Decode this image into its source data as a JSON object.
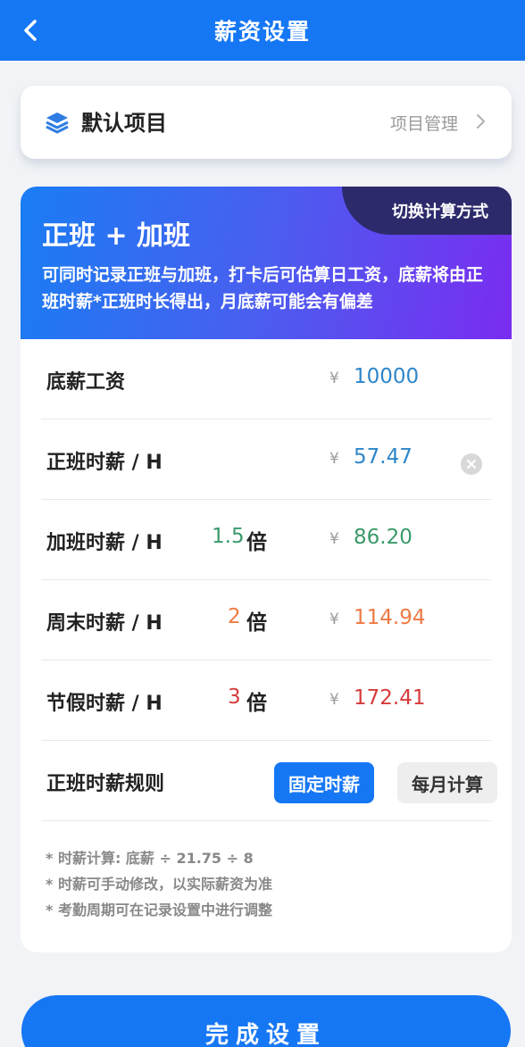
{
  "header": {
    "title": "薪资设置"
  },
  "default_project": {
    "label": "默认项目",
    "manage": "项目管理"
  },
  "mode": {
    "switch_label": "切换计算方式",
    "title": "正班 + 加班",
    "description": "可同时记录正班与加班，打卡后可估算日工资，底薪将由正班时薪*正班时长得出，月底薪可能会有偏差"
  },
  "currency_symbol": "¥",
  "rows": {
    "base": {
      "name": "底薪工资",
      "amount": "10000",
      "color": "#2e86c9"
    },
    "regular": {
      "name": "正班时薪 / H",
      "amount": "57.47",
      "color": "#2e86c9"
    },
    "overtime": {
      "name": "加班时薪 / H",
      "multiplier": "1.5",
      "unit": "倍",
      "amount": "86.20",
      "color": "#3a9a6a"
    },
    "weekend": {
      "name": "周末时薪 / H",
      "multiplier": "2",
      "unit": "倍",
      "amount": "114.94",
      "color": "#ee7a45"
    },
    "holiday": {
      "name": "节假时薪 / H",
      "multiplier": "3",
      "unit": "倍",
      "amount": "172.41",
      "color": "#d63b3b"
    }
  },
  "rule": {
    "name": "正班时薪规则",
    "option_fixed": "固定时薪",
    "option_monthly": "每月计算"
  },
  "notes": [
    "* 时薪计算: 底薪 ÷ 21.75 ÷ 8",
    "* 时薪可手动修改，以实际薪资为准",
    "* 考勤周期可在记录设置中进行调整"
  ],
  "done_label": "完成设置"
}
